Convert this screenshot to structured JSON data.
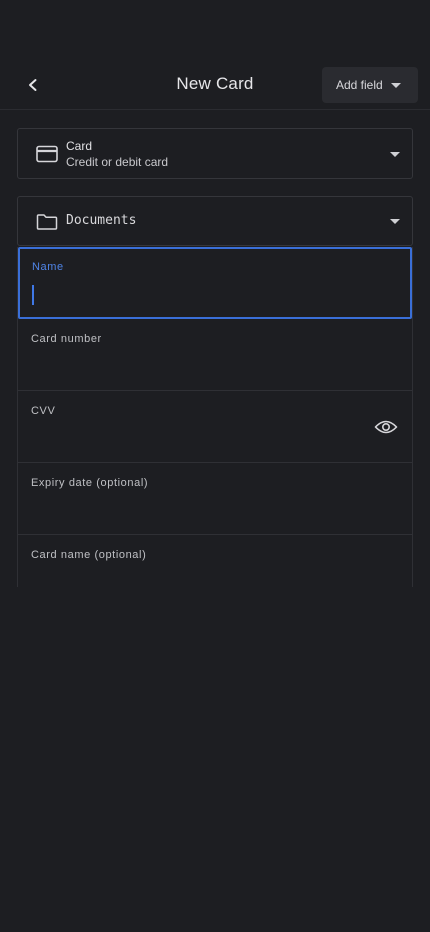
{
  "header": {
    "title": "New Card",
    "add_field_label": "Add field"
  },
  "type_selector": {
    "title": "Card",
    "subtitle": "Credit or debit card",
    "icon": "credit-card-icon"
  },
  "folder_selector": {
    "label": "Documents",
    "icon": "folder-icon"
  },
  "fields": {
    "name": {
      "label": "Name",
      "value": ""
    },
    "card_number": {
      "label": "Card number",
      "value": ""
    },
    "cvv": {
      "label": "CVV",
      "value": ""
    },
    "expiry": {
      "label": "Expiry date (optional)",
      "value": ""
    },
    "card_name": {
      "label": "Card name (optional)",
      "value": ""
    }
  },
  "colors": {
    "background": "#1d1e22",
    "accent": "#3a6fd8",
    "border": "#35363b"
  }
}
